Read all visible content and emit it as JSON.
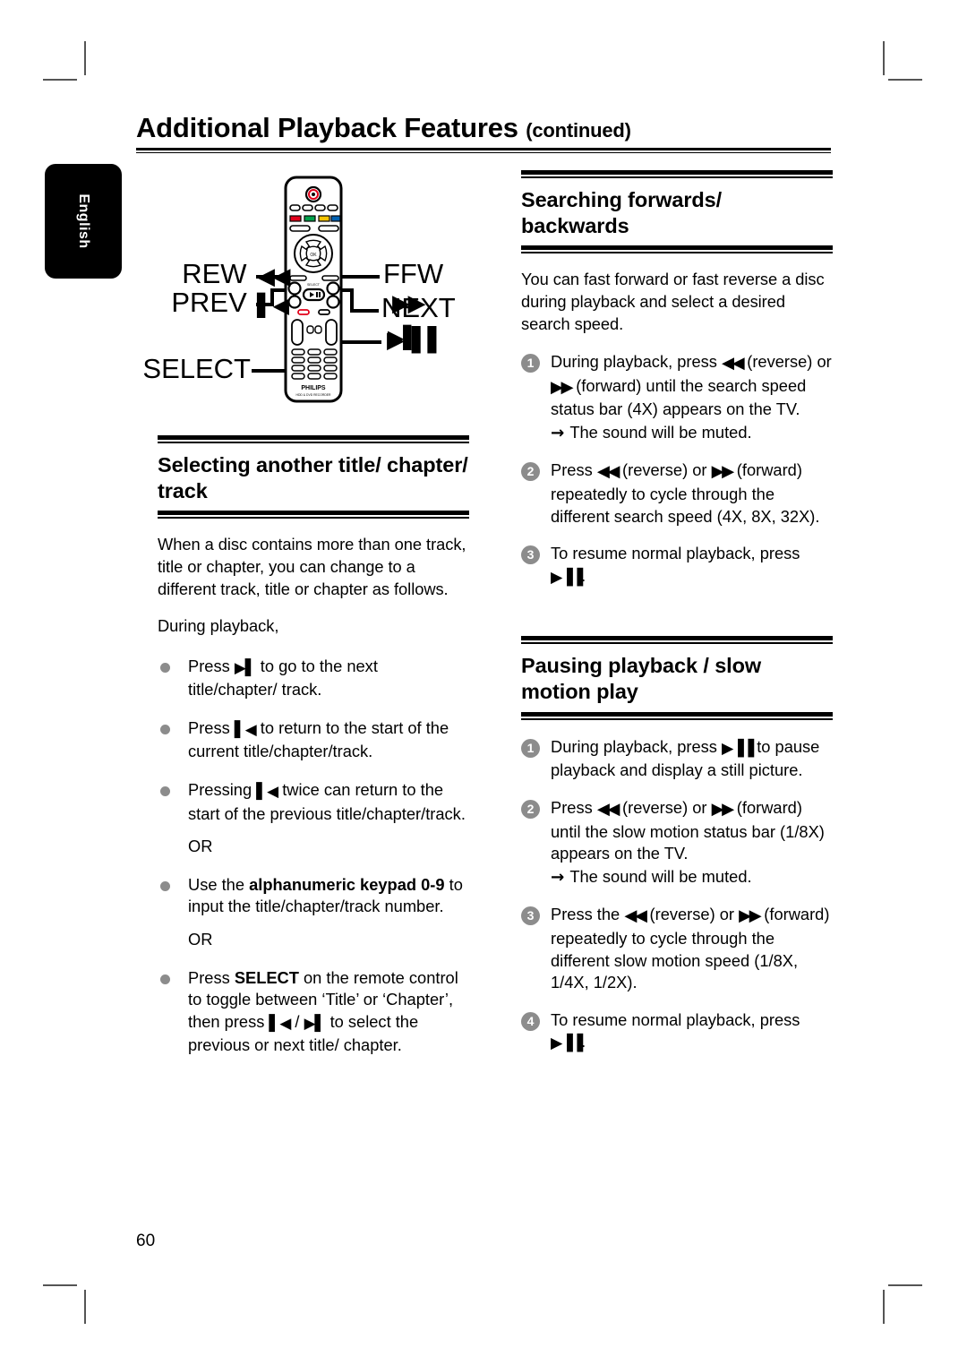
{
  "page": {
    "title_main": "Additional Playback Features",
    "title_suffix": "(continued)",
    "language_tab": "English",
    "page_number": "60"
  },
  "figure": {
    "name": "remote-control-diagram",
    "brand": "PHILIPS",
    "model_line": "HDD & DVD RECORDER",
    "callouts": {
      "rew": "REW",
      "prev": "PREV",
      "select": "SELECT",
      "ffw": "FFW",
      "next": "NEXT"
    },
    "glyphs": {
      "rew": "◀◀",
      "prev": "▌◀",
      "ffw": "▶▶",
      "next": "▶▌",
      "play_pause": "▶▐▐"
    }
  },
  "left_column": {
    "section": {
      "heading": "Selecting another title/ chapter/ track",
      "intro": "When a disc contains more than one track, title or chapter, you can change to a different track, title or chapter as follows.",
      "during_playback": "During playback,",
      "bullets": [
        {
          "pre": "Press ",
          "glyph": "next",
          "post": " to go to the next title/chapter/ track."
        },
        {
          "pre": "Press ",
          "glyph": "prev",
          "post": " to return to the start of the current title/chapter/track."
        },
        {
          "pre": "Pressing ",
          "glyph": "prev",
          "post": " twice can return to the start of the previous title/chapter/track."
        }
      ],
      "or_1": "OR",
      "bullet_keypad": {
        "pre": "Use the ",
        "bold": "alphanumeric keypad 0-9",
        "post": " to input the title/chapter/track number."
      },
      "or_2": "OR",
      "bullet_select": {
        "pre": "Press ",
        "bold": "SELECT",
        "mid": " on the remote control to toggle between ‘Title’ or ‘Chapter’, then press ",
        "glyph_prev": "prev",
        "sep": " / ",
        "glyph_next": "next",
        "post": " to select the previous or next title/ chapter."
      }
    }
  },
  "right_column": {
    "section_search": {
      "heading": "Searching forwards/ backwards",
      "intro": "You can fast forward or fast reverse a disc during playback and select a desired search speed.",
      "steps": [
        {
          "num": "1",
          "segments": [
            {
              "t": "During playback, press "
            },
            {
              "g": "rev"
            },
            {
              "t": " (reverse) or "
            },
            {
              "g": "fwd"
            },
            {
              "t": " (forward) until the search speed status bar (4X) appears on the TV."
            }
          ],
          "sub": "The sound will be muted."
        },
        {
          "num": "2",
          "segments": [
            {
              "t": "Press "
            },
            {
              "g": "rev"
            },
            {
              "t": " (reverse) or "
            },
            {
              "g": "fwd"
            },
            {
              "t": " (forward) repeatedly to cycle through the different search speed (4X, 8X, 32X)."
            }
          ],
          "sub": ""
        },
        {
          "num": "3",
          "segments": [
            {
              "t": "To resume normal playback, press "
            },
            {
              "g": "playpause"
            },
            {
              "t": "."
            }
          ],
          "sub": ""
        }
      ]
    },
    "section_pause": {
      "heading": "Pausing playback / slow motion play",
      "steps": [
        {
          "num": "1",
          "segments": [
            {
              "t": "During playback, press "
            },
            {
              "g": "playpause"
            },
            {
              "t": " to pause playback and display a still picture."
            }
          ],
          "sub": ""
        },
        {
          "num": "2",
          "segments": [
            {
              "t": "Press "
            },
            {
              "g": "rev"
            },
            {
              "t": " (reverse) or "
            },
            {
              "g": "fwd"
            },
            {
              "t": " (forward) until the slow motion status bar (1/8X) appears on the TV."
            }
          ],
          "sub": "The sound will be muted."
        },
        {
          "num": "3",
          "segments": [
            {
              "t": "Press the "
            },
            {
              "g": "rev"
            },
            {
              "t": " (reverse) or "
            },
            {
              "g": "fwd"
            },
            {
              "t": " (forward) repeatedly to cycle through the different slow motion speed (1/8X, 1/4X, 1/2X)."
            }
          ],
          "sub": ""
        },
        {
          "num": "4",
          "segments": [
            {
              "t": "To resume normal playback, press "
            },
            {
              "g": "playpause"
            },
            {
              "t": "."
            }
          ],
          "sub": ""
        }
      ]
    }
  },
  "colors": {
    "text": "#000000",
    "bullet_gray": "#8c8c8c",
    "tab_bg": "#000000",
    "remote_red": "#e2001a",
    "remote_green": "#00a04a",
    "remote_yellow": "#f5c400",
    "remote_blue": "#0060b0"
  }
}
